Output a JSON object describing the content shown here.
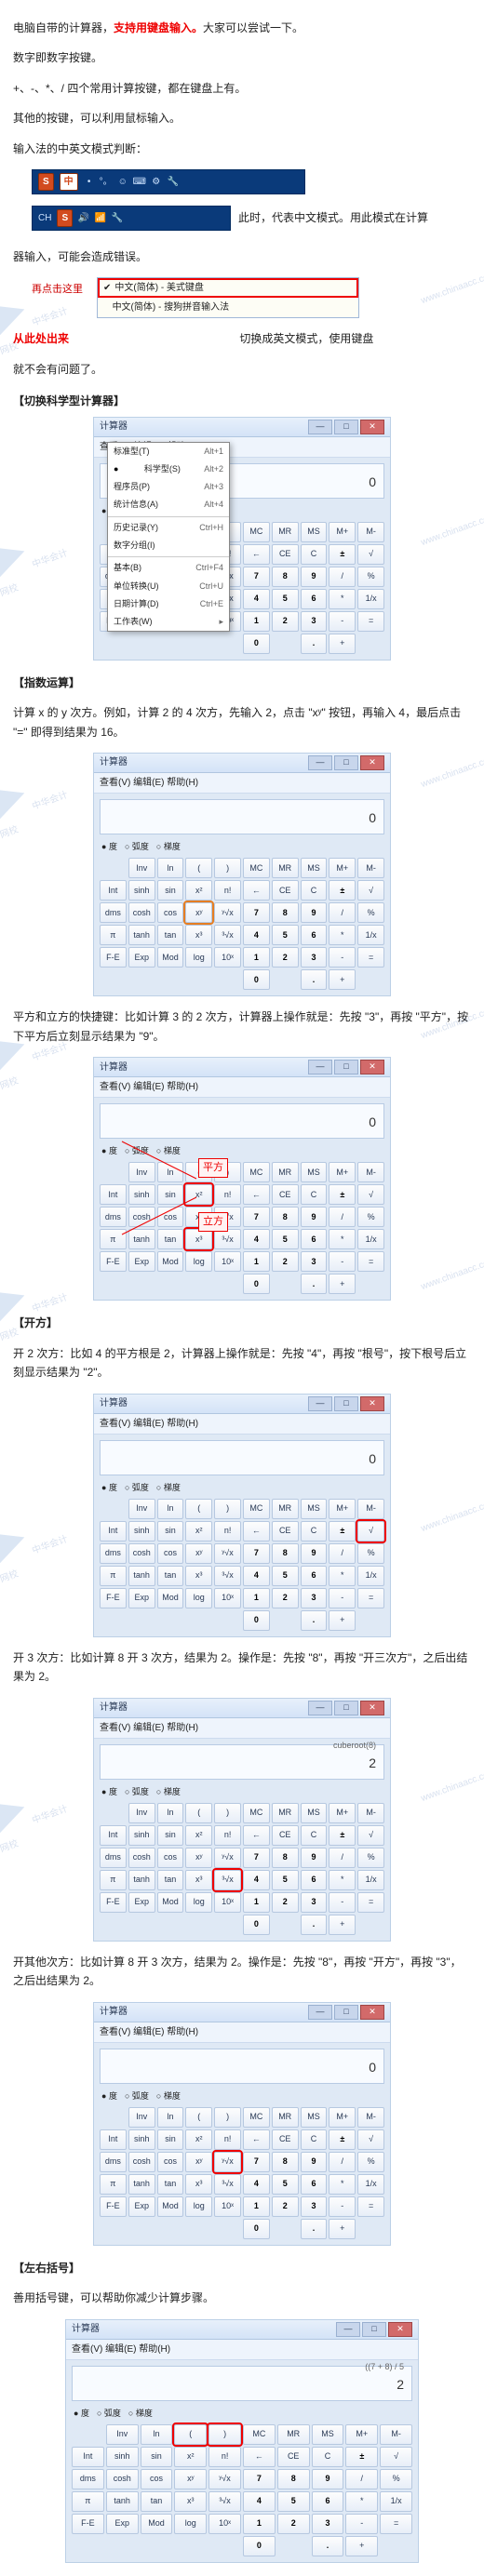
{
  "intro": {
    "line1_a": "电脑自带的计算器，",
    "line1_b": "支持用键盘输入。",
    "line1_c": "大家可以尝试一下。",
    "line2": "数字即数字按键。",
    "line3": "+、-、*、/ 四个常用计算按键，都在键盘上有。",
    "line4": "其他的按键，可以利用鼠标输入。",
    "line5": "输入法的中英文模式判断："
  },
  "ime": {
    "s_label": "S",
    "cn_label": "中",
    "ch_label": "CH",
    "strip2_after": "此时，代表中文模式。用此模式在计算",
    "after_strip2": "器输入，可能会造成错误。",
    "hint_click": "再点击这里",
    "popup_opt1": "中文(简体) - 美式键盘",
    "popup_opt2": "中文(简体) - 搜狗拼音输入法",
    "hint_from_here": "从此处出来",
    "after_popup": "切换成英文模式，使用键盘",
    "after_popup2": "就不会有问题了。"
  },
  "sec1": {
    "title": "【切换科学型计算器】",
    "calc_title": "计算器",
    "menu": "查看(V)  编辑(E)  帮助(H)",
    "display": "0",
    "view_items": [
      {
        "label": "标准型(T)",
        "accel": "Alt+1"
      },
      {
        "label": "科学型(S)",
        "accel": "Alt+2",
        "sel": true
      },
      {
        "label": "程序员(P)",
        "accel": "Alt+3"
      },
      {
        "label": "统计信息(A)",
        "accel": "Alt+4"
      },
      {
        "sep": true
      },
      {
        "label": "历史记录(Y)",
        "accel": "Ctrl+H"
      },
      {
        "label": "数字分组(I)",
        "accel": ""
      },
      {
        "sep": true
      },
      {
        "label": "基本(B)",
        "accel": "Ctrl+F4"
      },
      {
        "label": "单位转换(U)",
        "accel": "Ctrl+U"
      },
      {
        "label": "日期计算(D)",
        "accel": "Ctrl+E"
      },
      {
        "label": "工作表(W)",
        "accel": "▸"
      }
    ]
  },
  "modes": {
    "deg": "度",
    "rad": "弧度",
    "grad": "梯度"
  },
  "keys_sci": [
    "",
    "Inv",
    "ln",
    "(",
    ")",
    "MC",
    "MR",
    "MS",
    "M+",
    "M-",
    "Int",
    "sinh",
    "sin",
    "x²",
    "n!",
    "←",
    "CE",
    "C",
    "±",
    "√",
    "dms",
    "cosh",
    "cos",
    "xʸ",
    "ʸ√x",
    "7",
    "8",
    "9",
    "/",
    "%",
    "π",
    "tanh",
    "tan",
    "x³",
    "³√x",
    "4",
    "5",
    "6",
    "*",
    "1/x",
    "F-E",
    "Exp",
    "Mod",
    "log",
    "10ˣ",
    "1",
    "2",
    "3",
    "-",
    "=",
    "",
    "",
    "",
    "",
    "",
    "0",
    "",
    ".",
    "+",
    ""
  ],
  "sec2": {
    "title": "【指数运算】",
    "para": "计算 x 的 y 次方。例如，计算 2 的 4 次方，先输入 2，点击 \"xʸ\" 按钮，再输入 4，最后点击 \"=\" 即得到结果为 16。",
    "display": "0",
    "hl_keys": [
      "xʸ"
    ]
  },
  "sec2b": {
    "para": "平方和立方的快捷键：比如计算 3 的 2 次方，计算器上操作就是：先按 \"3\"，再按 \"平方\"，按下平方后立刻显示结果为 \"9\"。",
    "display": "0",
    "ann_sq": "平方",
    "ann_cu": "立方",
    "hl_keys": [
      "x²",
      "x³"
    ]
  },
  "sec3": {
    "title": "【开方】",
    "para": "开 2 次方：比如 4 的平方根是 2，计算器上操作就是：先按 \"4\"，再按 \"根号\"，按下根号后立刻显示结果为 \"2\"。",
    "display": "0",
    "hl_keys": [
      "√"
    ]
  },
  "sec3b": {
    "para": "开 3 次方：比如计算 8 开 3 次方，结果为 2。操作是：先按 \"8\"，再按 \"开三次方\"，之后出结果为 2。",
    "display_sub": "cuberoot(8)",
    "display": "2",
    "hl_keys": [
      "³√x"
    ]
  },
  "sec3c": {
    "para": "开其他次方：比如计算 8 开 3 次方，结果为 2。操作是：先按 \"8\"，再按 \"开方\"，再按 \"3\"，之后出结果为 2。",
    "display": "0",
    "hl_keys": [
      "ʸ√x"
    ]
  },
  "sec4": {
    "title": "【左右括号】",
    "para": "善用括号键，可以帮助你减少计算步骤。",
    "display_sub": "((7 + 8) / 5",
    "display": "2",
    "hl_keys": [
      "(",
      ")"
    ]
  },
  "watermark": {
    "text": "中华会计网校",
    "url": "www.chinaacc.com"
  }
}
